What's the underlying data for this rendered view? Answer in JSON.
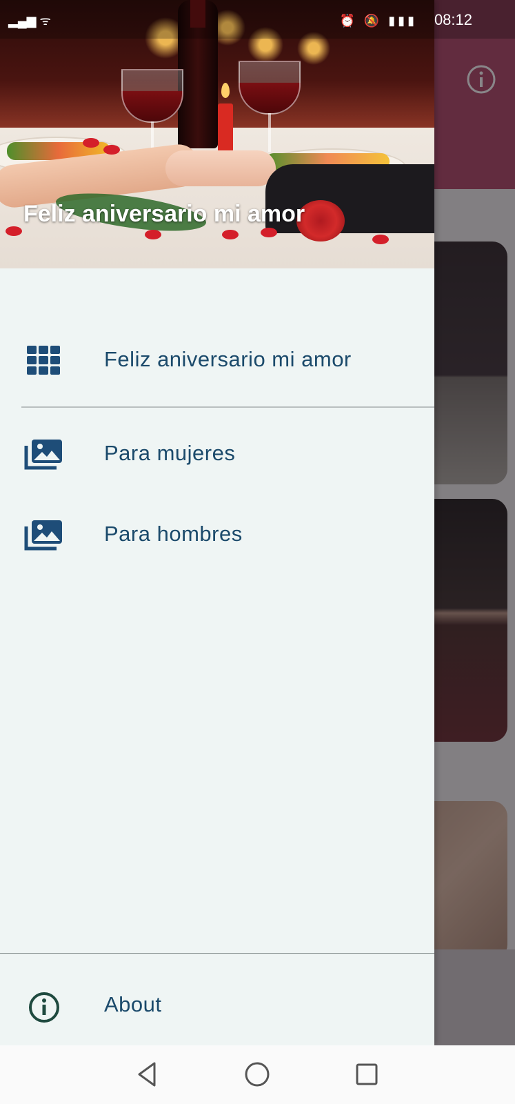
{
  "status_bar": {
    "time": "08:12",
    "icons": [
      "wifi-icon",
      "alarm-icon",
      "mute-icon",
      "battery-icon"
    ]
  },
  "drawer": {
    "header_title": "Feliz aniversario mi amor",
    "items": [
      {
        "label": "Feliz aniversario mi amor",
        "icon": "apps-grid-icon"
      },
      {
        "label": "Para mujeres",
        "icon": "photo-library-icon"
      },
      {
        "label": "Para hombres",
        "icon": "photo-library-icon"
      }
    ],
    "about": {
      "label": "About",
      "icon": "info-icon"
    }
  },
  "background_app": {
    "toolbar_icon": "info-icon"
  },
  "colors": {
    "drawer_background": "#eff5f4",
    "item_text": "#1b4a6b",
    "icon_blue": "#1e4d78",
    "about_icon": "#1f4a3f",
    "app_bar": "#a9395c"
  },
  "nav_bar": {
    "buttons": [
      "back-icon",
      "home-icon",
      "recents-icon"
    ]
  }
}
